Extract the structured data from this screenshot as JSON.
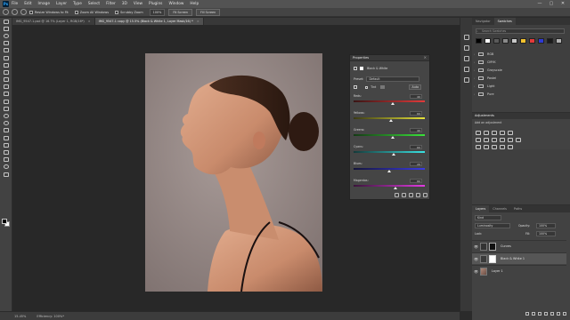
{
  "app": {
    "name": "Ps"
  },
  "menu": [
    "File",
    "Edit",
    "Image",
    "Layer",
    "Type",
    "Select",
    "Filter",
    "3D",
    "View",
    "Plugins",
    "Window",
    "Help"
  ],
  "window_controls": [
    "—",
    "▢",
    "✕"
  ],
  "options_bar": {
    "resize_windows_label": "Resize Windows to Fit",
    "zoom_all_label": "Zoom All Windows",
    "scrubby_zoom_label": "Scrubby Zoom",
    "zoom_value": "100%",
    "fit_screen_label": "Fit Screen",
    "fill_screen_label": "Fill Screen"
  },
  "doc_tabs": [
    {
      "title": "IMG_9547-1.psd @ 16.7% (Layer 1, RGB/16*)",
      "close": "×",
      "active": false
    },
    {
      "title": "IMG_9547-1 copy @ 15.5% (Black & White 1, Layer Mask/16) *",
      "close": "×",
      "active": true
    }
  ],
  "status_bar": {
    "zoom": "15.45%",
    "efficiency": "Efficiency: 100%*"
  },
  "properties": {
    "title": "Properties",
    "close": "×",
    "adjustment_name": "Black & White",
    "preset_label": "Preset:",
    "preset_value": "Default",
    "tint_label": "Tint",
    "auto_label": "Auto",
    "sliders": [
      {
        "label": "Reds:",
        "value": "40",
        "pct": 0.55,
        "grad": "linear-gradient(90deg,#3a1414,#e23a3a)"
      },
      {
        "label": "Yellows:",
        "value": "60",
        "pct": 0.53,
        "grad": "linear-gradient(90deg,#3a3a14,#e6e23a)"
      },
      {
        "label": "Greens:",
        "value": "40",
        "pct": 0.55,
        "grad": "linear-gradient(90deg,#143a14,#3ae23a)"
      },
      {
        "label": "Cyans:",
        "value": "60",
        "pct": 0.56,
        "grad": "linear-gradient(90deg,#143a3a,#3ae2e2)"
      },
      {
        "label": "Blues:",
        "value": "20",
        "pct": 0.5,
        "grad": "linear-gradient(90deg,#14143a,#3a3ae2)"
      },
      {
        "label": "Magentas:",
        "value": "80",
        "pct": 0.59,
        "grad": "linear-gradient(90deg,#3a143a,#e23ae2)"
      }
    ]
  },
  "swatches_panel": {
    "tabs": [
      {
        "label": "Navigator",
        "active": false
      },
      {
        "label": "Swatches",
        "active": true
      }
    ],
    "search_placeholder": "Search Swatches",
    "recent_colors": [
      "#000000",
      "#ffffff",
      "#5a5a5a",
      "#8a8a8a",
      "#c8c8c8",
      "#f2c12e",
      "#e23a3a",
      "#2e3ad4",
      "#1a1a1a",
      "#b0b0b0"
    ],
    "folders": [
      "RGB",
      "CMYK",
      "Grayscale",
      "Pastel",
      "Light",
      "Pure"
    ]
  },
  "adjustments_panel": {
    "title": "Adjustments",
    "subtitle": "Add an adjustment"
  },
  "layers_panel": {
    "tabs": [
      {
        "label": "Layers",
        "active": true
      },
      {
        "label": "Channels",
        "active": false
      },
      {
        "label": "Paths",
        "active": false
      }
    ],
    "kind_label": "Kind",
    "blend_mode": "Luminosity",
    "opacity_label": "Opacity:",
    "opacity_value": "100%",
    "lock_label": "Lock:",
    "fill_label": "Fill:",
    "fill_value": "100%",
    "layers": [
      {
        "name": "Curves",
        "eye": "👁",
        "selected": false
      },
      {
        "name": "Black & White 1",
        "eye": "👁",
        "selected": true
      },
      {
        "name": "Layer 1",
        "eye": "👁",
        "selected": false
      }
    ]
  }
}
